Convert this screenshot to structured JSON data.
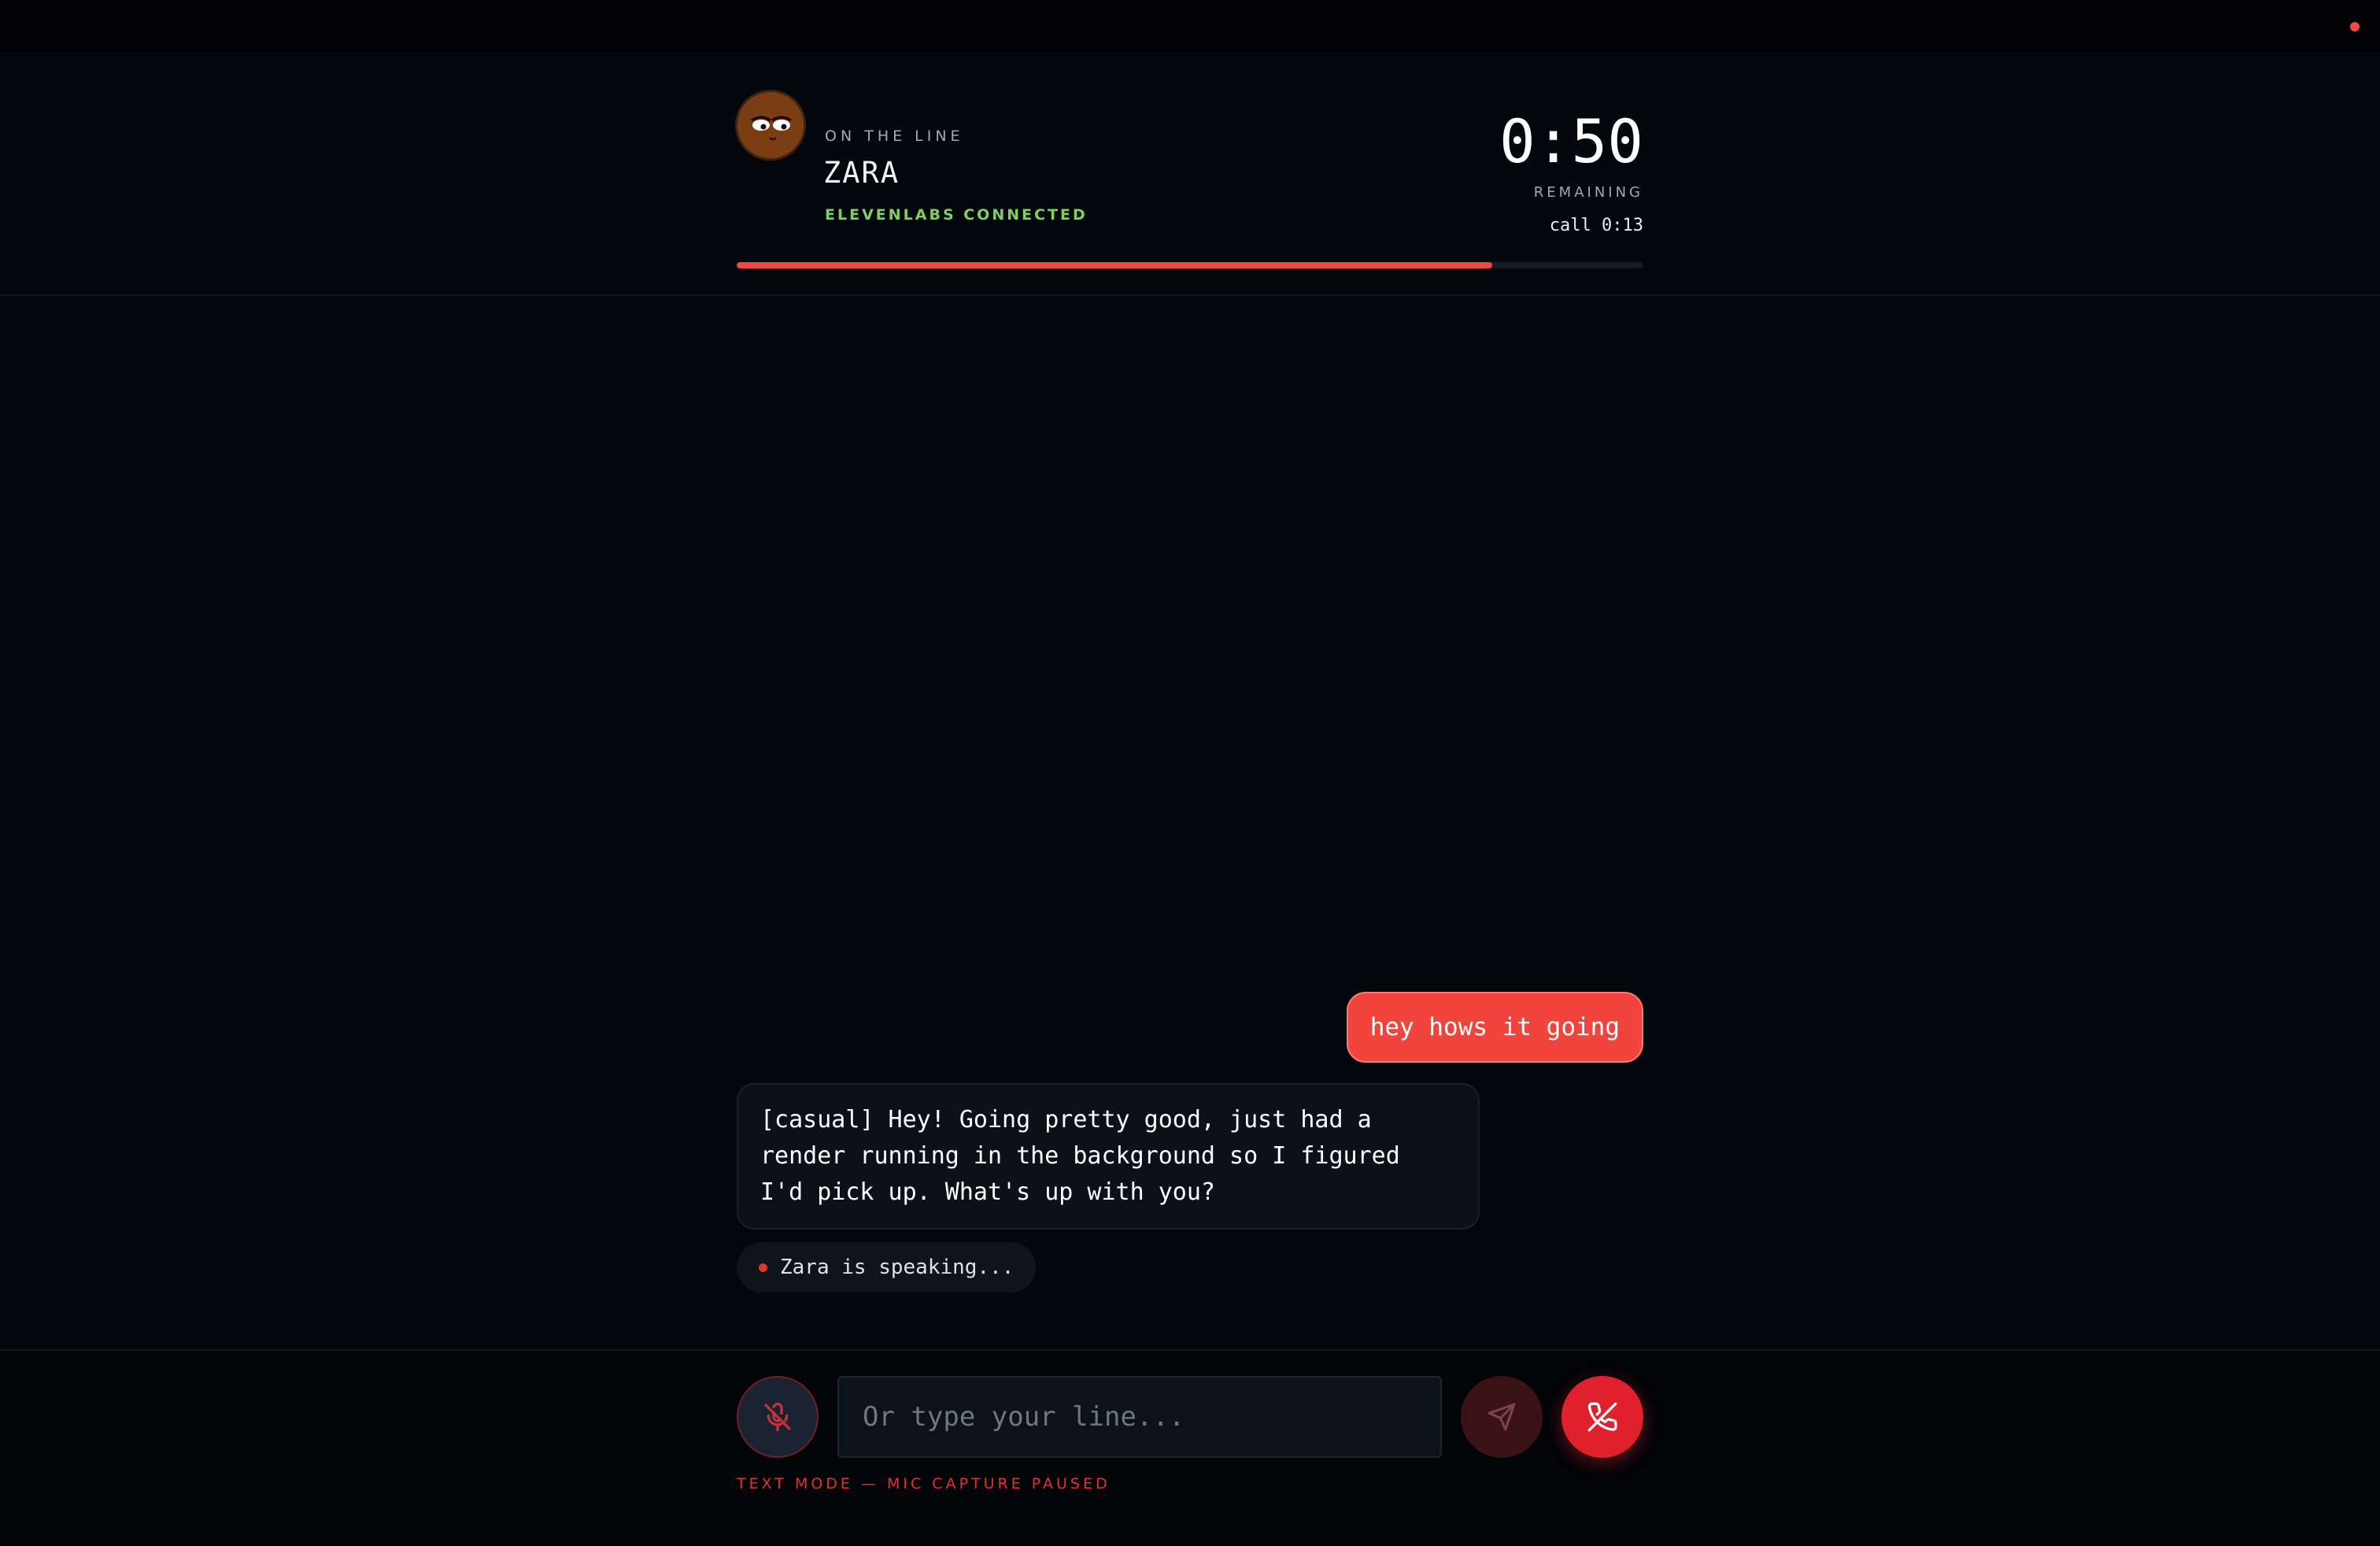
{
  "header": {
    "caption": "ON THE LINE",
    "contact_name": "ZARA",
    "connection_status": "ELEVENLABS CONNECTED",
    "timer": "0:50",
    "timer_caption": "REMAINING",
    "call_time": "call 0:13",
    "progress_fraction": 0.833,
    "avatar_icon": "cartoon-face-icon"
  },
  "conversation": {
    "messages": [
      {
        "role": "user",
        "text": "hey hows it going"
      },
      {
        "role": "agent",
        "text": "[casual] Hey! Going pretty good, just had a render running in the background so I figured I'd pick up. What's up with you?"
      }
    ],
    "speaking_indicator": "Zara is speaking..."
  },
  "footer": {
    "input_placeholder": "Or type your line...",
    "input_value": "",
    "mode_caption": "TEXT MODE — MIC CAPTURE PAUSED",
    "mic_icon": "mic-off-icon",
    "send_icon": "send-icon",
    "end_icon": "phone-hangup-icon"
  },
  "colors": {
    "accent": "#ef4a44",
    "connected": "#7fd15f",
    "end_call": "#e0202c",
    "background": "#03060a"
  }
}
